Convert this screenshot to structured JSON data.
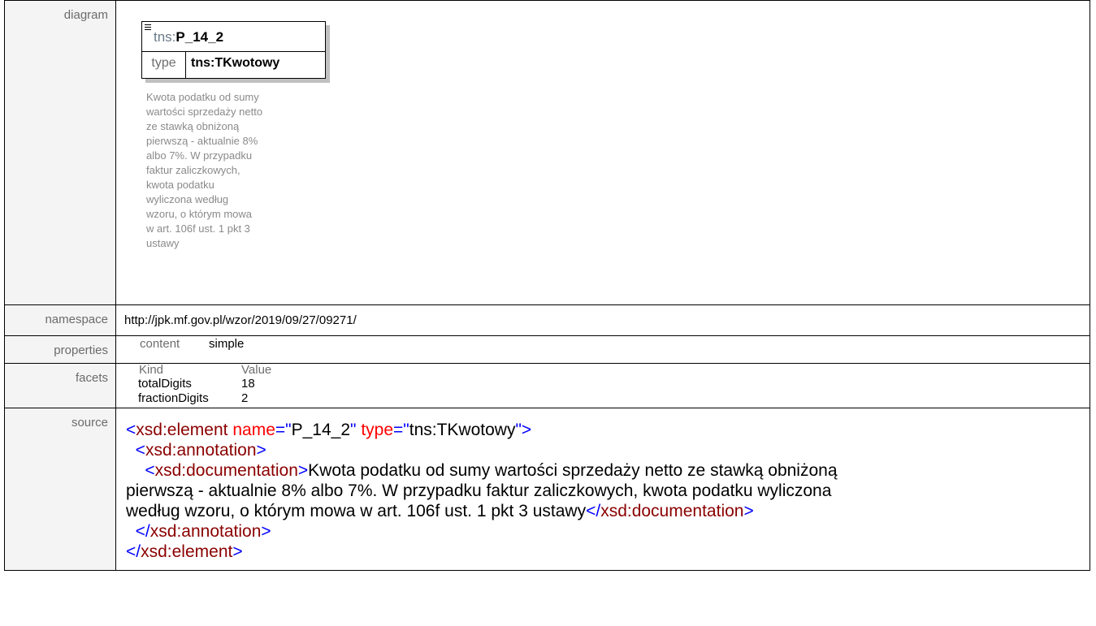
{
  "rows": {
    "diagram_label": "diagram",
    "namespace_label": "namespace",
    "properties_label": "properties",
    "facets_label": "facets",
    "source_label": "source"
  },
  "diagram": {
    "prefix": "tns:",
    "name": "P_14_2",
    "type_label": "type",
    "type_value": "tns:TKwotowy",
    "documentation_lines": [
      "Kwota podatku od sumy",
      "wartości sprzedaży netto",
      "ze stawką obniżoną",
      "pierwszą - aktualnie 8%",
      "albo 7%. W przypadku",
      "faktur zaliczkowych,",
      "kwota podatku",
      "wyliczona według",
      "wzoru, o którym mowa",
      "w art. 106f ust. 1 pkt 3",
      "ustawy"
    ]
  },
  "namespace": "http://jpk.mf.gov.pl/wzor/2019/09/27/09271/",
  "properties": {
    "key": "content",
    "value": "simple"
  },
  "facets": {
    "kind_header": "Kind",
    "value_header": "Value",
    "items": [
      {
        "kind": "totalDigits",
        "value": "18"
      },
      {
        "kind": "fractionDigits",
        "value": "2"
      }
    ]
  },
  "source": {
    "open_tag": "xsd:element",
    "attr_name": "name",
    "attr_name_value": "P_14_2",
    "attr_type": "type",
    "attr_type_value": "tns:TKwotowy",
    "annotation_tag": "xsd:annotation",
    "documentation_tag": "xsd:documentation",
    "doc_line1": "Kwota podatku od sumy wartości sprzedaży netto ze stawką obniżoną",
    "doc_line2": "pierwszą - aktualnie 8% albo 7%. W przypadku faktur zaliczkowych, kwota podatku wyliczona",
    "doc_line3": "według wzoru, o którym mowa w art. 106f ust. 1 pkt 3 ustawy"
  },
  "colors": {
    "tag": "#8b0000",
    "bracket": "#0000ff",
    "attribute": "#ff0000",
    "label_bg": "#f4f4f4"
  }
}
